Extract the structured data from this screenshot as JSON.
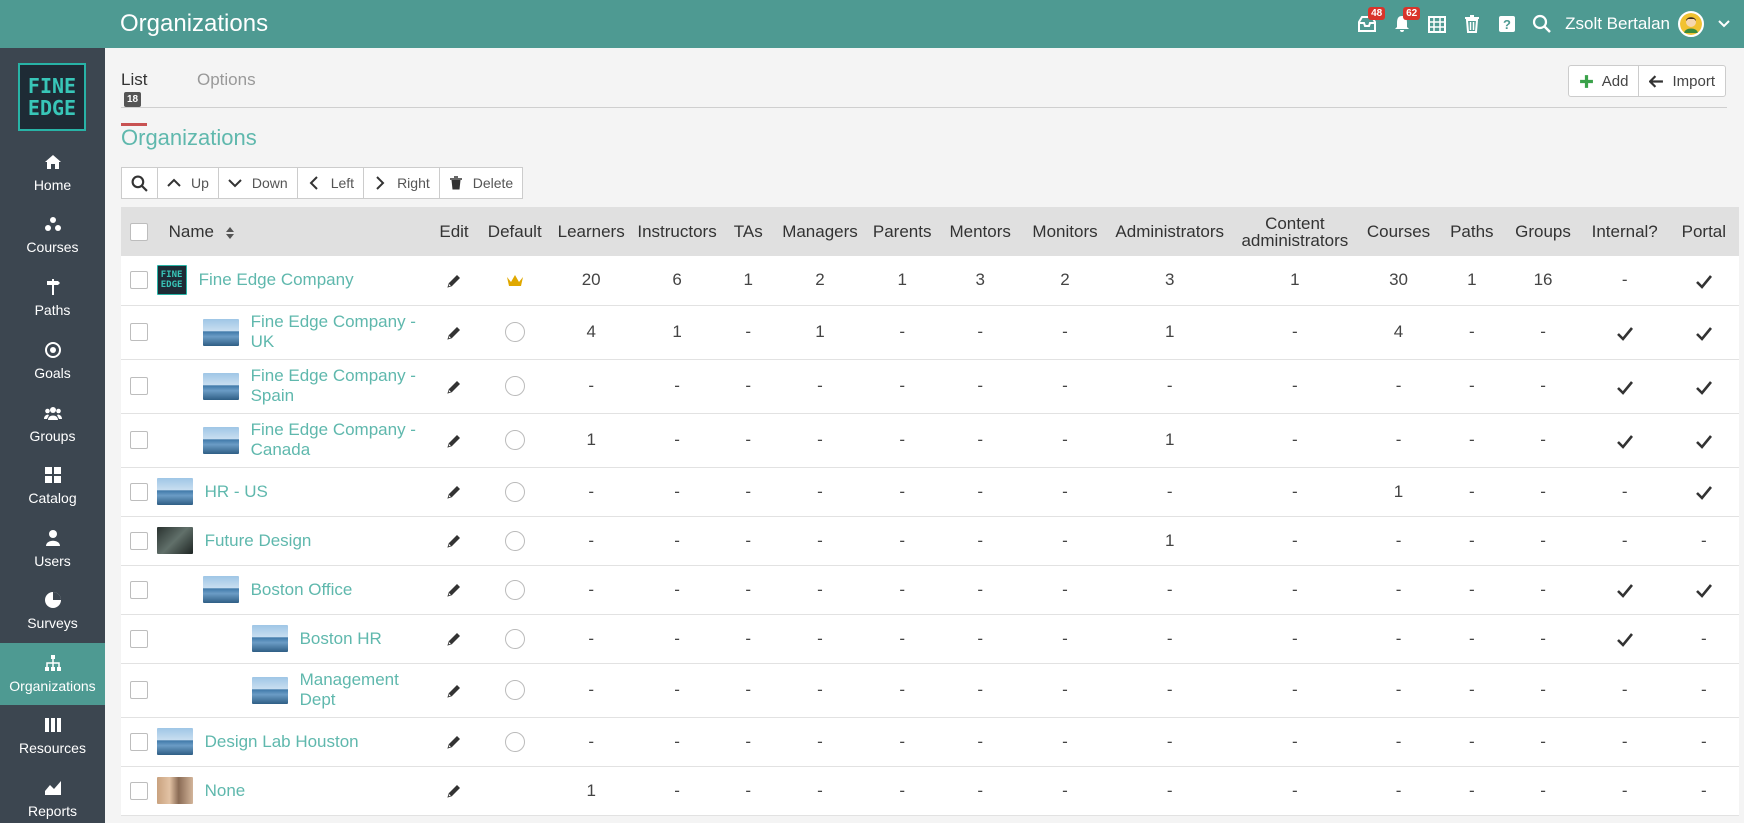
{
  "header": {
    "title": "Organizations",
    "messages_badge": "48",
    "notifications_badge": "62",
    "user_name": "Zsolt Bertalan"
  },
  "sidebar": {
    "logo_line1": "FINE",
    "logo_line2": "EDGE",
    "items": [
      {
        "label": "Home",
        "icon": "home-icon"
      },
      {
        "label": "Courses",
        "icon": "courses-icon"
      },
      {
        "label": "Paths",
        "icon": "paths-icon"
      },
      {
        "label": "Goals",
        "icon": "goals-icon"
      },
      {
        "label": "Groups",
        "icon": "groups-icon"
      },
      {
        "label": "Catalog",
        "icon": "catalog-icon"
      },
      {
        "label": "Users",
        "icon": "users-icon"
      },
      {
        "label": "Surveys",
        "icon": "surveys-icon"
      },
      {
        "label": "Organizations",
        "icon": "organizations-icon"
      },
      {
        "label": "Resources",
        "icon": "resources-icon"
      },
      {
        "label": "Reports",
        "icon": "reports-icon"
      }
    ],
    "active": "Organizations"
  },
  "tabs": {
    "list_label": "List",
    "list_count": "18",
    "options_label": "Options"
  },
  "actions": {
    "add_label": "Add",
    "import_label": "Import"
  },
  "section_title": "Organizations",
  "toolbar": {
    "up": "Up",
    "down": "Down",
    "left": "Left",
    "right": "Right",
    "delete": "Delete"
  },
  "table": {
    "columns": {
      "name": "Name",
      "edit": "Edit",
      "default": "Default",
      "learners": "Learners",
      "instructors": "Instructors",
      "tas": "TAs",
      "managers": "Managers",
      "parents": "Parents",
      "mentors": "Mentors",
      "monitors": "Monitors",
      "administrators": "Administrators",
      "content_admins_line1": "Content",
      "content_admins_line2": "administrators",
      "courses": "Courses",
      "paths": "Paths",
      "groups": "Groups",
      "internal": "Internal?",
      "portal": "Portal"
    },
    "rows": [
      {
        "name": "Fine Edge Company",
        "level": 0,
        "thumb": "logo",
        "default": "crown",
        "values": [
          "20",
          "6",
          "1",
          "2",
          "1",
          "3",
          "2",
          "3",
          "1",
          "30",
          "1",
          "16"
        ],
        "internal": "-",
        "portal": "check"
      },
      {
        "name": "Fine Edge Company - UK",
        "level": 1,
        "thumb": "building",
        "default": "radio",
        "values": [
          "4",
          "1",
          "-",
          "1",
          "-",
          "-",
          "-",
          "1",
          "-",
          "4",
          "-",
          "-"
        ],
        "internal": "check",
        "portal": "check"
      },
      {
        "name": "Fine Edge Company - Spain",
        "level": 1,
        "thumb": "building",
        "default": "radio",
        "values": [
          "-",
          "-",
          "-",
          "-",
          "-",
          "-",
          "-",
          "-",
          "-",
          "-",
          "-",
          "-"
        ],
        "internal": "check",
        "portal": "check"
      },
      {
        "name": "Fine Edge Company - Canada",
        "level": 1,
        "thumb": "building",
        "default": "radio",
        "values": [
          "1",
          "-",
          "-",
          "-",
          "-",
          "-",
          "-",
          "1",
          "-",
          "-",
          "-",
          "-"
        ],
        "internal": "check",
        "portal": "check"
      },
      {
        "name": "HR - US",
        "level": 0,
        "thumb": "building",
        "default": "radio",
        "values": [
          "-",
          "-",
          "-",
          "-",
          "-",
          "-",
          "-",
          "-",
          "-",
          "1",
          "-",
          "-"
        ],
        "internal": "-",
        "portal": "check"
      },
      {
        "name": "Future Design",
        "level": 0,
        "thumb": "dark",
        "default": "radio",
        "values": [
          "-",
          "-",
          "-",
          "-",
          "-",
          "-",
          "-",
          "1",
          "-",
          "-",
          "-",
          "-"
        ],
        "internal": "-",
        "portal": "-"
      },
      {
        "name": "Boston Office",
        "level": 1,
        "thumb": "building",
        "default": "radio",
        "values": [
          "-",
          "-",
          "-",
          "-",
          "-",
          "-",
          "-",
          "-",
          "-",
          "-",
          "-",
          "-"
        ],
        "internal": "check",
        "portal": "check"
      },
      {
        "name": "Boston HR",
        "level": 2,
        "thumb": "building",
        "default": "radio",
        "values": [
          "-",
          "-",
          "-",
          "-",
          "-",
          "-",
          "-",
          "-",
          "-",
          "-",
          "-",
          "-"
        ],
        "internal": "check",
        "portal": "-"
      },
      {
        "name": "Management Dept",
        "level": 2,
        "thumb": "building",
        "default": "radio",
        "values": [
          "-",
          "-",
          "-",
          "-",
          "-",
          "-",
          "-",
          "-",
          "-",
          "-",
          "-",
          "-"
        ],
        "internal": "-",
        "portal": "-"
      },
      {
        "name": "Design Lab Houston",
        "level": 0,
        "thumb": "building",
        "default": "radio",
        "values": [
          "-",
          "-",
          "-",
          "-",
          "-",
          "-",
          "-",
          "-",
          "-",
          "-",
          "-",
          "-"
        ],
        "internal": "-",
        "portal": "-"
      },
      {
        "name": "None",
        "level": 0,
        "thumb": "people",
        "default": "none",
        "values": [
          "1",
          "-",
          "-",
          "-",
          "-",
          "-",
          "-",
          "-",
          "-",
          "-",
          "-",
          "-"
        ],
        "internal": "-",
        "portal": "-"
      }
    ]
  }
}
